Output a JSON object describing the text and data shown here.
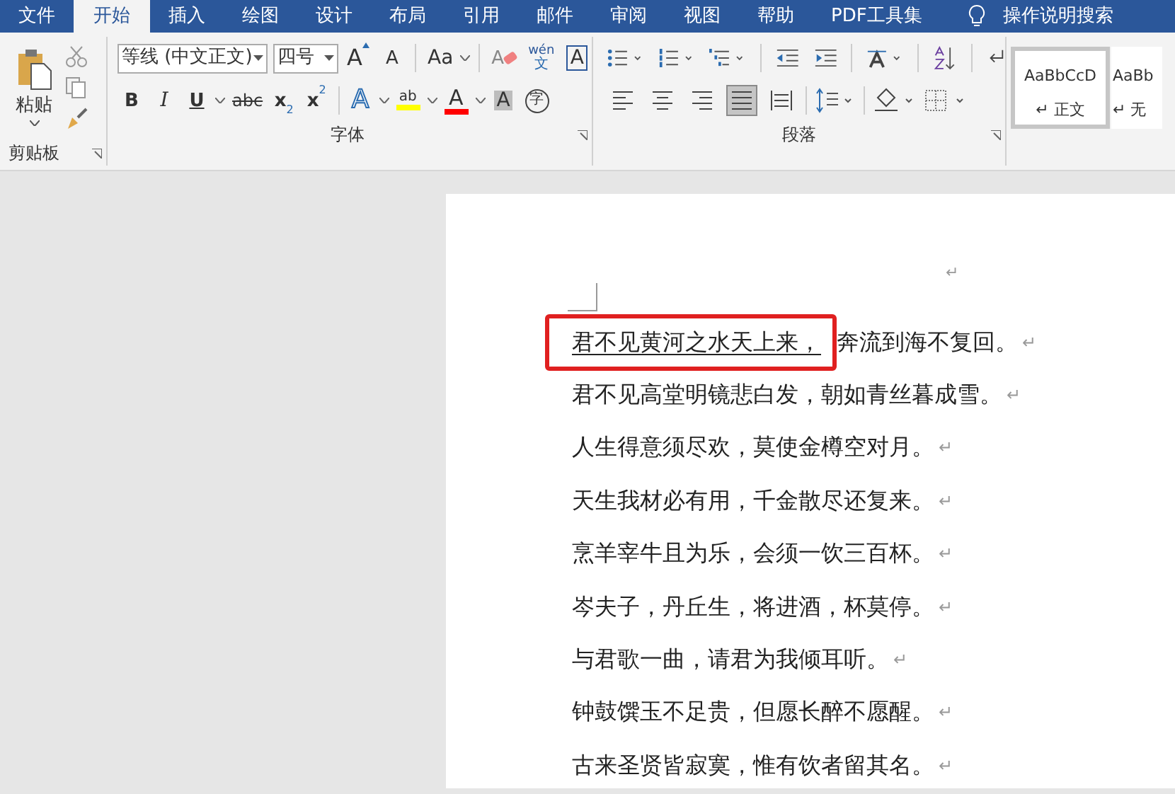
{
  "tabs": [
    {
      "label": "文件",
      "selected": false
    },
    {
      "label": "开始",
      "selected": true
    },
    {
      "label": "插入",
      "selected": false
    },
    {
      "label": "绘图",
      "selected": false
    },
    {
      "label": "设计",
      "selected": false
    },
    {
      "label": "布局",
      "selected": false
    },
    {
      "label": "引用",
      "selected": false
    },
    {
      "label": "邮件",
      "selected": false
    },
    {
      "label": "审阅",
      "selected": false
    },
    {
      "label": "视图",
      "selected": false
    },
    {
      "label": "帮助",
      "selected": false
    },
    {
      "label": "PDF工具集",
      "selected": false
    }
  ],
  "tell_me": "操作说明搜索",
  "clipboard": {
    "paste_label": "粘贴",
    "group_label": "剪贴板"
  },
  "font": {
    "font_name": "等线 (中文正文)",
    "font_size": "四号",
    "group_label": "字体",
    "row1": [
      {
        "kind": "grow",
        "label": "A"
      },
      {
        "kind": "shrink",
        "label": "A"
      },
      {
        "kind": "case",
        "label": "Aa"
      },
      {
        "kind": "clear",
        "label": "A"
      },
      {
        "kind": "pinyin",
        "label": "wén",
        "sub": "文"
      },
      {
        "kind": "border",
        "label": "A"
      }
    ],
    "row2": [
      {
        "kind": "bold",
        "label": "B"
      },
      {
        "kind": "italic",
        "label": "I"
      },
      {
        "kind": "underline",
        "label": "U"
      },
      {
        "kind": "strike",
        "label": "abc"
      },
      {
        "kind": "sub",
        "label": "x",
        "script": "2"
      },
      {
        "kind": "sup",
        "label": "x",
        "script": "2"
      },
      {
        "kind": "effect",
        "label": "A"
      },
      {
        "kind": "highlight",
        "label": "ab",
        "color": "#ffff00"
      },
      {
        "kind": "fontcolor",
        "label": "A",
        "color": "#ff0000"
      },
      {
        "kind": "shade",
        "label": "A"
      },
      {
        "kind": "enclose",
        "label": "字"
      }
    ]
  },
  "paragraph": {
    "group_label": "段落",
    "alignment": [
      {
        "selected": false
      },
      {
        "selected": false
      },
      {
        "selected": false
      },
      {
        "selected": true
      },
      {
        "selected": false
      }
    ]
  },
  "styles": [
    {
      "preview": "AaBbCcD",
      "mark": "↵",
      "name": "正文",
      "selected": true
    },
    {
      "preview": "AaBb",
      "mark": "↵",
      "name": "无",
      "selected": false
    }
  ],
  "document": {
    "top_mark": "↵",
    "lines": [
      {
        "boxed": "君不见黄河之水天上来，",
        "text": "奔流到海不复回。",
        "mark": "↵"
      },
      {
        "text": "君不见高堂明镜悲白发，朝如青丝暮成雪。",
        "mark": "↵"
      },
      {
        "text": "人生得意须尽欢，莫使金樽空对月。",
        "mark": "↵"
      },
      {
        "text": "天生我材必有用，千金散尽还复来。",
        "mark": "↵"
      },
      {
        "text": "烹羊宰牛且为乐，会须一饮三百杯。",
        "mark": "↵"
      },
      {
        "text": "岑夫子，丹丘生，将进酒，杯莫停。",
        "mark": "↵"
      },
      {
        "text": "与君歌一曲，请君为我倾耳听。",
        "mark": "↵"
      },
      {
        "text": "钟鼓馔玉不足贵，但愿长醉不愿醒。",
        "mark": "↵"
      },
      {
        "text": "古来圣贤皆寂寞，惟有饮者留其名。",
        "mark": "↵"
      }
    ]
  }
}
